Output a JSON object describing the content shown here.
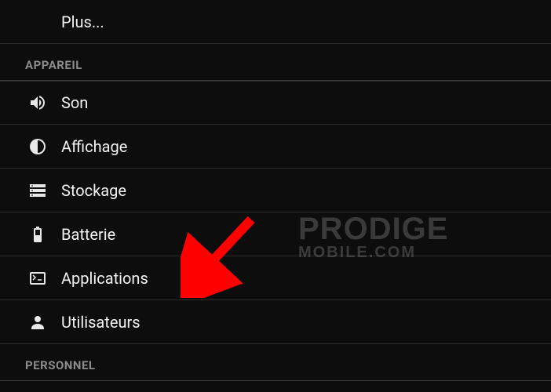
{
  "top_item": {
    "label": "Plus..."
  },
  "sections": {
    "appareil": {
      "header": "APPAREIL",
      "items": [
        {
          "icon": "sound-icon",
          "label": "Son"
        },
        {
          "icon": "display-icon",
          "label": "Affichage"
        },
        {
          "icon": "storage-icon",
          "label": "Stockage"
        },
        {
          "icon": "battery-icon",
          "label": "Batterie"
        },
        {
          "icon": "apps-icon",
          "label": "Applications"
        },
        {
          "icon": "users-icon",
          "label": "Utilisateurs"
        }
      ]
    },
    "personnel": {
      "header": "PERSONNEL"
    }
  },
  "watermark": {
    "line1": "PRODIGE",
    "line2": "MOBILE.COM"
  },
  "annotation_arrow": {
    "color": "#ff0000"
  }
}
